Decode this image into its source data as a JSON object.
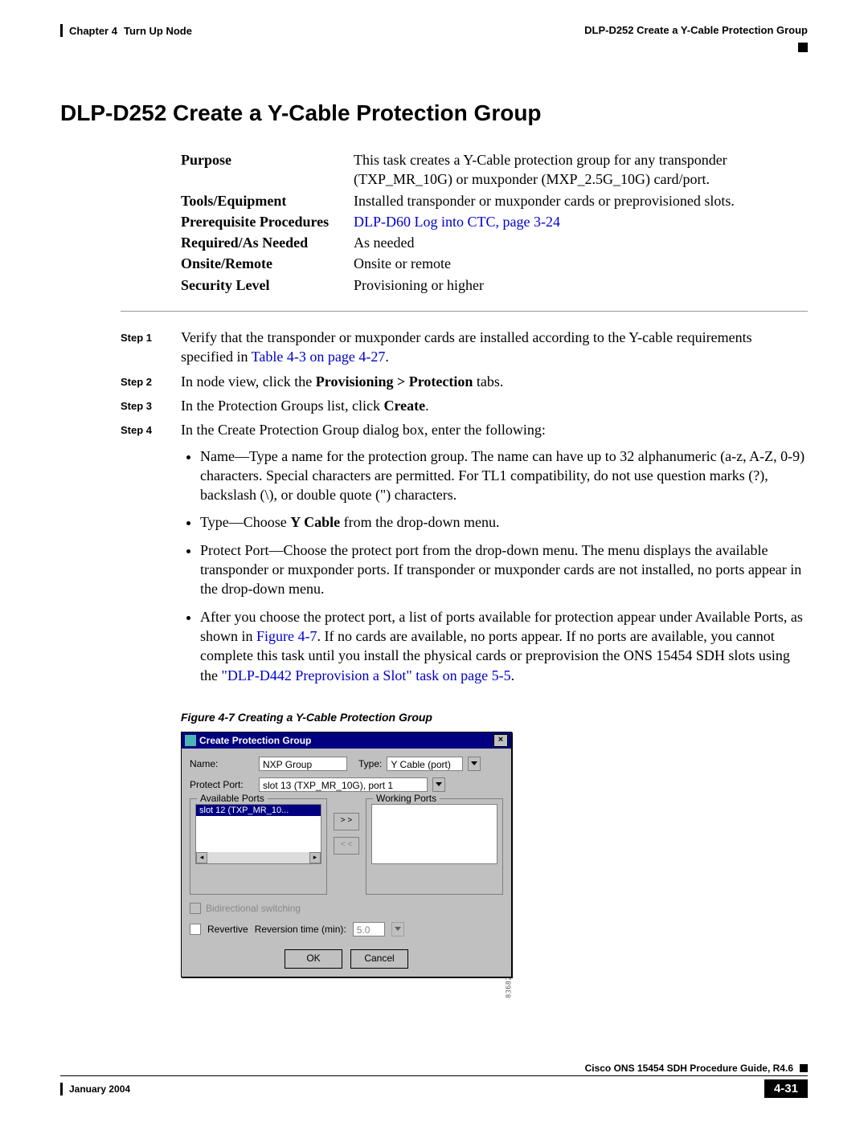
{
  "header": {
    "chapter": "Chapter 4",
    "chapter_title": "Turn Up Node",
    "section": "DLP-D252 Create a Y-Cable Protection Group"
  },
  "title": "DLP-D252 Create a Y-Cable Protection Group",
  "info": {
    "purpose_label": "Purpose",
    "purpose_value": "This task creates a Y-Cable protection group for any transponder (TXP_MR_10G) or muxponder (MXP_2.5G_10G) card/port.",
    "tools_label": "Tools/Equipment",
    "tools_value": "Installed transponder or muxponder cards or preprovisioned slots.",
    "prereq_label": "Prerequisite Procedures",
    "prereq_value": "DLP-D60 Log into CTC, page 3-24",
    "required_label": "Required/As Needed",
    "required_value": "As needed",
    "onsite_label": "Onsite/Remote",
    "onsite_value": "Onsite or remote",
    "security_label": "Security Level",
    "security_value": "Provisioning or higher"
  },
  "steps": {
    "s1_label": "Step 1",
    "s1_a": "Verify that the transponder or muxponder cards are installed according to the Y-cable requirements specified in ",
    "s1_link": "Table 4-3 on page 4-27",
    "s1_b": ".",
    "s2_label": "Step 2",
    "s2_a": "In node view, click the ",
    "s2_bold": "Provisioning > Protection",
    "s2_b": " tabs.",
    "s3_label": "Step 3",
    "s3_a": "In the Protection Groups list, click ",
    "s3_bold": "Create",
    "s3_b": ".",
    "s4_label": "Step 4",
    "s4_text": "In the Create Protection Group dialog box, enter the following:",
    "b1": "Name—Type a name for the protection group. The name can have up to 32 alphanumeric (a-z, A-Z, 0-9) characters. Special characters are permitted. For TL1 compatibility, do not use question marks (?), backslash (\\), or double quote (\") characters.",
    "b2_a": "Type—Choose ",
    "b2_bold": "Y Cable",
    "b2_b": " from the drop-down menu.",
    "b3": "Protect Port—Choose the protect port from the drop-down menu. The menu displays the available transponder or muxponder ports. If transponder or muxponder cards are not installed, no ports appear in the drop-down menu.",
    "b4_a": "After you choose the protect port, a list of ports available for protection appear under Available Ports, as shown in ",
    "b4_link1": "Figure 4-7",
    "b4_b": ". If no cards are available, no ports appear. If no ports are available, you cannot complete this task until you install the physical cards or preprovision the ONS 15454 SDH slots using the ",
    "b4_link2": "\"DLP-D442 Preprovision a Slot\" task on page 5-5",
    "b4_c": "."
  },
  "figure": {
    "caption": "Figure 4-7    Creating a Y-Cable Protection Group",
    "imgnum": "83682"
  },
  "dialog": {
    "title": "Create Protection Group",
    "name_label": "Name:",
    "name_value": "NXP Group",
    "type_label": "Type:",
    "type_value": "Y Cable (port)",
    "protect_label": "Protect Port:",
    "protect_value": "slot 13 (TXP_MR_10G), port 1",
    "avail_label": "Available Ports",
    "work_label": "Working Ports",
    "avail_item": "slot 12 (TXP_MR_10...",
    "move_right": "> >",
    "move_left": "< <",
    "bidi_label": "Bidirectional switching",
    "rev_label": "Revertive",
    "revtime_label": "Reversion time (min):",
    "revtime_value": "5.0",
    "ok": "OK",
    "cancel": "Cancel"
  },
  "footer": {
    "guide": "Cisco ONS 15454 SDH Procedure Guide, R4.6",
    "date": "January 2004",
    "pagenum": "4-31"
  }
}
